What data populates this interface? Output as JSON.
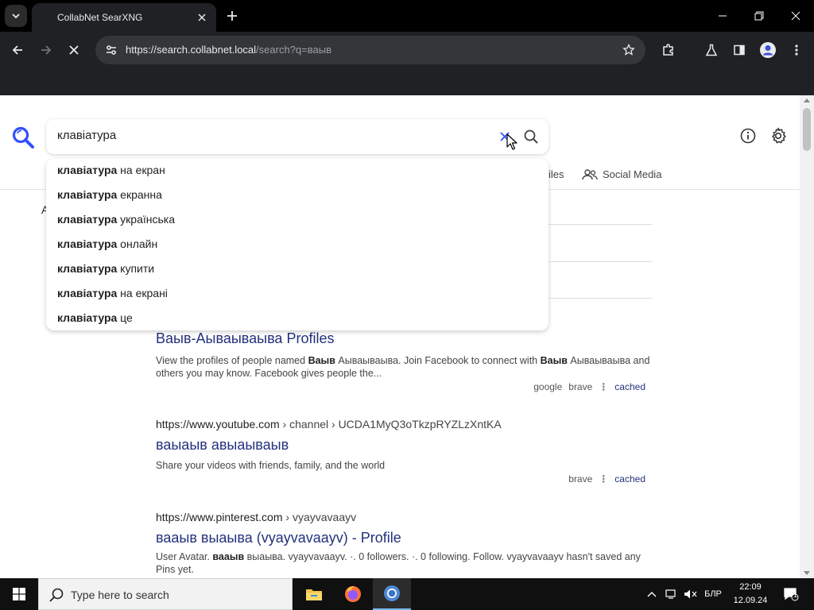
{
  "browser": {
    "tab_title": "CollabNet SearXNG",
    "url_host": "https://search.collabnet.local",
    "url_path": "/search?q=ваыв"
  },
  "search": {
    "query": "клавіатура"
  },
  "autocomplete": [
    {
      "bold": "клавіатура",
      "rest": " на екран"
    },
    {
      "bold": "клавіатура",
      "rest": " екранна"
    },
    {
      "bold": "клавіатура",
      "rest": " українська"
    },
    {
      "bold": "клавіатура",
      "rest": " онлайн"
    },
    {
      "bold": "клавіатура",
      "rest": " купити"
    },
    {
      "bold": "клавіатура",
      "rest": " на екрані"
    },
    {
      "bold": "клавіатура",
      "rest": " це"
    }
  ],
  "categories": {
    "files_partial": "iles",
    "social_media": "Social Media"
  },
  "sidebar_letter": "A",
  "results": [
    {
      "title": "Ваыв-Аываываыва Profiles",
      "desc_parts": [
        "View the profiles of people named ",
        "Ваыв",
        " Аываываыва. Join Facebook to connect with ",
        "Ваыв",
        " Аываываыва and others you may know. Facebook gives people the..."
      ],
      "engines": [
        "google",
        "brave"
      ],
      "cached": "cached"
    },
    {
      "url": "https://www.youtube.com",
      "crumbs": " › channel › UCDA1MyQ3oTkzpRYZLzXntKA",
      "title": "ваыаыв авыаываыв",
      "desc": "Share your videos with friends, family, and the world",
      "engines": [
        "brave"
      ],
      "cached": "cached"
    },
    {
      "url": "https://www.pinterest.com",
      "crumbs": " › vyayvavaayv",
      "title": "вааыв выаыва (vyayvavaayv) - Profile",
      "desc_parts": [
        "User Avatar. ",
        "вааыв",
        " выаыва. vyayvavaayv. ·. 0 followers. ·. 0 following. Follow. vyayvavaayv hasn't saved any Pins yet."
      ]
    }
  ],
  "taskbar": {
    "search_placeholder": "Type here to search",
    "lang": "БЛР",
    "time": "22:09",
    "date": "12.09.24",
    "notification_count": "1"
  }
}
